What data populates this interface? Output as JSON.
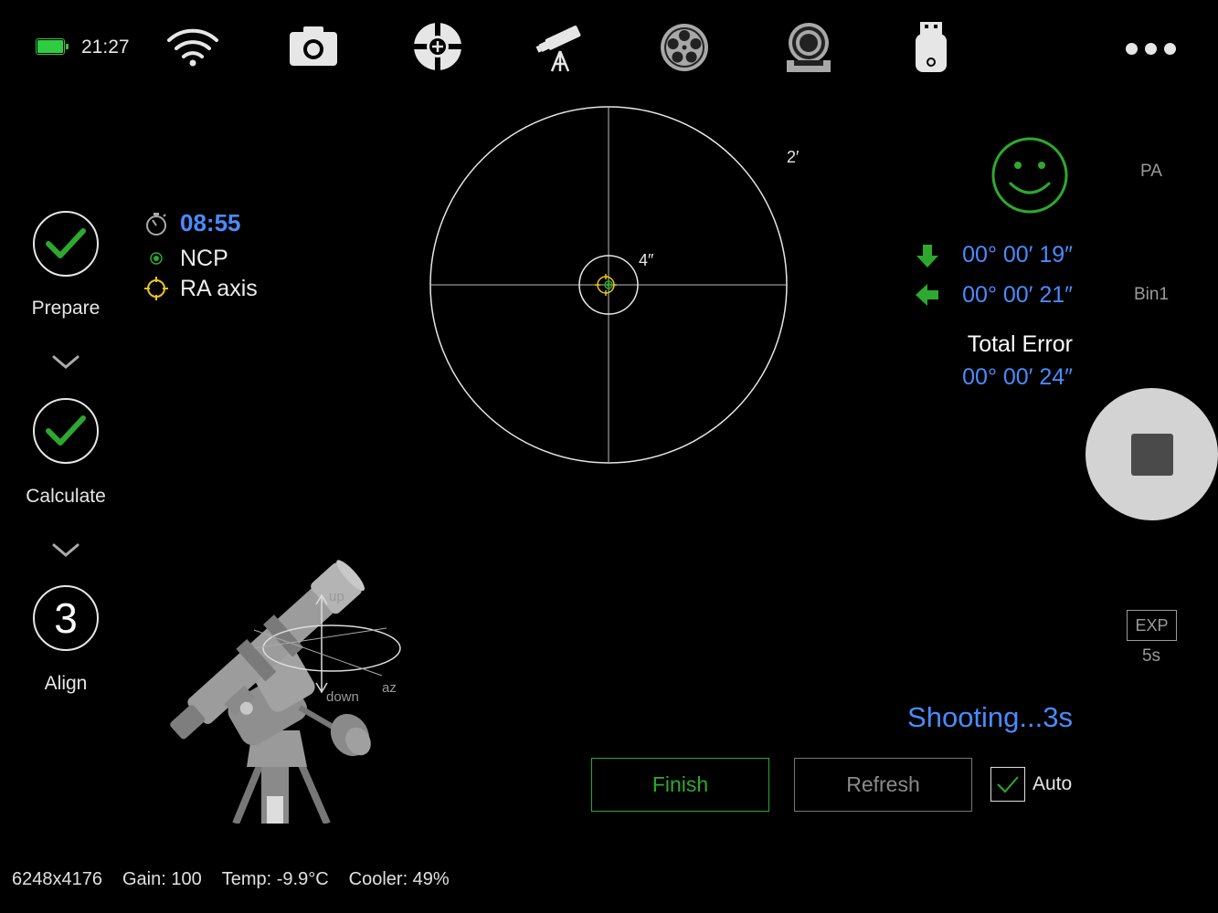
{
  "status_bar": {
    "time": "21:27",
    "battery_color": "#2ecc40"
  },
  "toolbar": {
    "icons": [
      "wifi-icon",
      "camera-icon",
      "focus-target-icon",
      "telescope-icon",
      "filter-wheel-icon",
      "focuser-icon",
      "usb-drive-icon",
      "more-icon"
    ]
  },
  "steps": [
    {
      "label": "Prepare",
      "state": "done"
    },
    {
      "label": "Calculate",
      "state": "done"
    },
    {
      "label": "Align",
      "state": "active",
      "number": "3"
    }
  ],
  "session": {
    "timer": "08:55",
    "ncp_label": "NCP",
    "ra_axis_label": "RA axis"
  },
  "target": {
    "outer_label": "2′",
    "inner_label": "4″"
  },
  "mount_diagram": {
    "up_label": "up",
    "down_label": "down",
    "az_label": "az"
  },
  "errors": {
    "altitude_error": "00° 00′ 19″",
    "azimuth_error": "00° 00′ 21″",
    "total_label": "Total Error",
    "total_error": "00° 00′ 24″",
    "status_face": "smiley-icon",
    "accent": "#4a8bff",
    "good_color": "#2ea82e"
  },
  "side": {
    "pa_label": "PA",
    "bin_label": "Bin1",
    "exp_label": "EXP",
    "exp_value": "5s"
  },
  "shooting_status": "Shooting...3s",
  "actions": {
    "finish_label": "Finish",
    "refresh_label": "Refresh",
    "auto_label": "Auto",
    "auto_checked": true
  },
  "camera_info": {
    "resolution": "6248x4176",
    "gain": "Gain: 100",
    "temp": "Temp: -9.9°C",
    "cooler": "Cooler: 49%"
  }
}
